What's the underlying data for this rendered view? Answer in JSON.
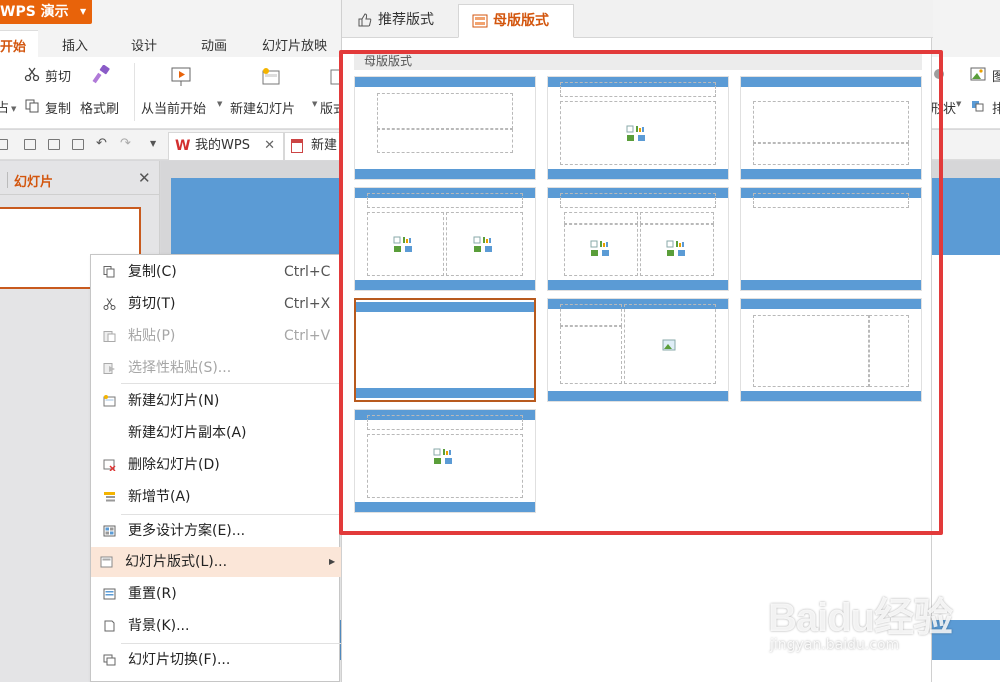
{
  "app": {
    "title": "WPS 演示"
  },
  "menu": {
    "tabs": [
      "开始",
      "插入",
      "设计",
      "动画",
      "幻灯片放映"
    ]
  },
  "ribbon": {
    "cut": "剪切",
    "copy": "复制",
    "format_painter": "格式刷",
    "from_current": "从当前开始",
    "new_slide": "新建幻灯片",
    "layout_partial": "版式",
    "left_partial": "占",
    "right_shape_partial": "形状",
    "right_img_partial": "图",
    "right_arrange_partial": "排"
  },
  "doc_tabs": {
    "tab1": "我的WPS",
    "tab2": "新建"
  },
  "slides_pane": {
    "title": "幻灯片"
  },
  "context_menu": {
    "items": [
      {
        "label": "复制(C)",
        "shortcut": "Ctrl+C"
      },
      {
        "label": "剪切(T)",
        "shortcut": "Ctrl+X"
      },
      {
        "label": "粘贴(P)",
        "shortcut": "Ctrl+V"
      },
      {
        "label": "选择性粘贴(S)..."
      },
      {
        "label": "新建幻灯片(N)"
      },
      {
        "label": "新建幻灯片副本(A)"
      },
      {
        "label": "删除幻灯片(D)"
      },
      {
        "label": "新增节(A)"
      },
      {
        "label": "更多设计方案(E)..."
      },
      {
        "label": "幻灯片版式(L)..."
      },
      {
        "label": "重置(R)"
      },
      {
        "label": "背景(K)..."
      },
      {
        "label": "幻灯片切换(F)..."
      }
    ]
  },
  "layout_panel": {
    "tabs": [
      "推荐版式",
      "母版版式"
    ],
    "section_title": "母版版式"
  },
  "watermark": {
    "main": "Baidu经验",
    "sub": "jingyan.baidu.com"
  },
  "colors": {
    "accent": "#d3560e",
    "app_button": "#e8630a",
    "layout_blue": "#5b9bd5",
    "highlight_red": "#e23a3a",
    "menu_hover": "#fbe6d8"
  }
}
